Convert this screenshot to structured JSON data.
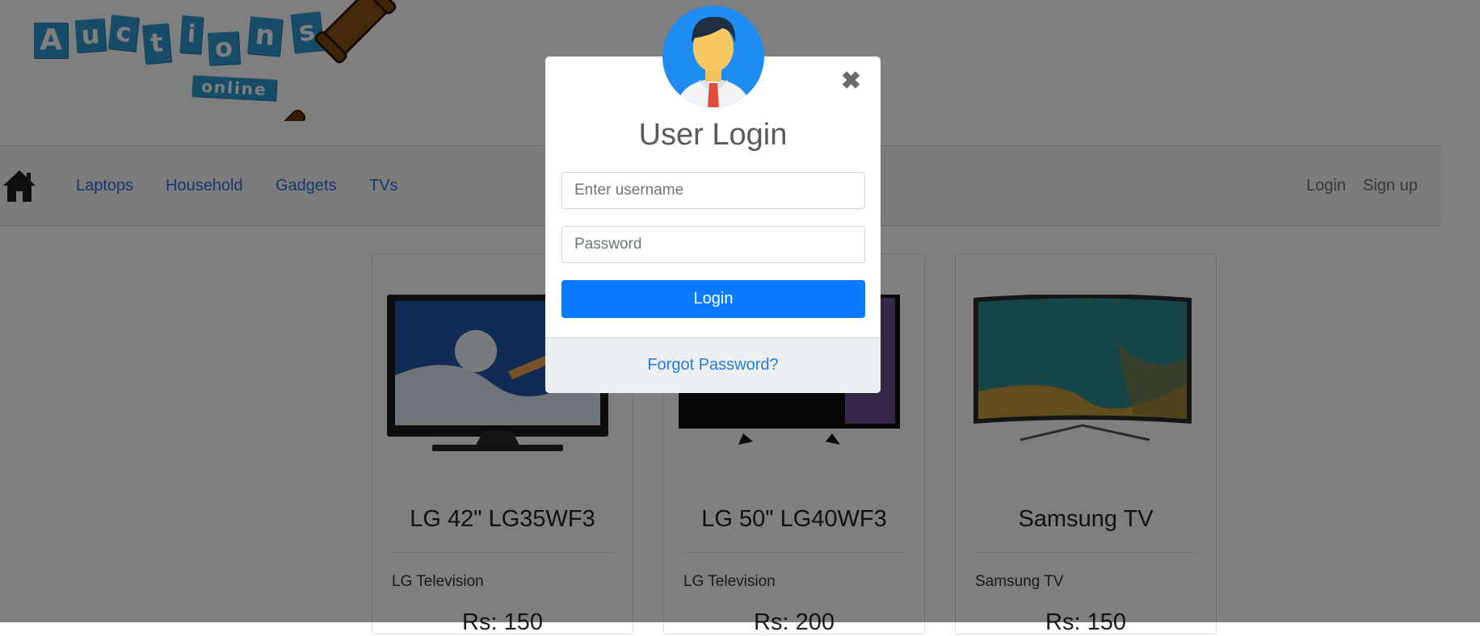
{
  "logo": {
    "letters": [
      "A",
      "u",
      "c",
      "t",
      "i",
      "o",
      "n",
      "s"
    ],
    "subtitle": "online",
    "icon": "gavel-icon"
  },
  "nav": {
    "home_icon": "home-icon",
    "items": [
      "Laptops",
      "Household",
      "Gadgets",
      "TVs"
    ],
    "login": "Login",
    "signup": "Sign up"
  },
  "products": [
    {
      "title": "LG 42\" LG35WF3",
      "description": "LG Television",
      "price": "Rs: 150"
    },
    {
      "title": "LG 50\" LG40WF3",
      "description": "LG Television",
      "price": "Rs: 200"
    },
    {
      "title": "Samsung TV",
      "description": "Samsung TV",
      "price": "Rs: 150"
    }
  ],
  "modal": {
    "avatar_icon": "user-avatar-icon",
    "close_icon": "close-icon",
    "close_symbol": "✖",
    "title": "User Login",
    "username_placeholder": "Enter username",
    "password_placeholder": "Password",
    "login_button": "Login",
    "forgot_password": "Forgot Password?"
  },
  "colors": {
    "primary": "#0a7bff",
    "link": "#2b71d8",
    "logo_blue": "#2f98d2",
    "avatar_bg": "#1e8cf0"
  }
}
